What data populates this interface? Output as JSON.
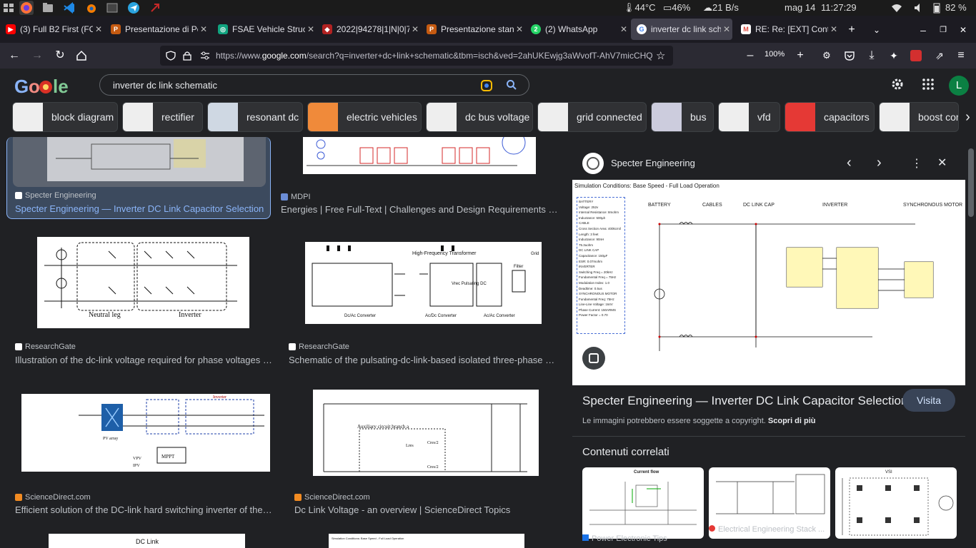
{
  "system": {
    "temperature": "44°C",
    "memory": "46%",
    "network": "21 B/s",
    "date": "mag 14",
    "time": "11:27:29",
    "battery": "82 %"
  },
  "tabs": [
    {
      "title": "(3) Full B2 First (FCE)",
      "color": "#ff0000",
      "glyph": "▶"
    },
    {
      "title": "Presentazione di Pov",
      "color": "#c55a11",
      "glyph": "P"
    },
    {
      "title": "FSAE Vehicle Structu",
      "color": "#10a37f",
      "glyph": "◎"
    },
    {
      "title": "2022|94278|1|N|0|74",
      "color": "#b22222",
      "glyph": "◆"
    },
    {
      "title": "Presentazione stand",
      "color": "#c55a11",
      "glyph": "P"
    },
    {
      "title": "(2) WhatsApp",
      "color": "#25d366",
      "glyph": "2"
    },
    {
      "title": "inverter dc link schen",
      "color": "#ffffff",
      "glyph": "G"
    },
    {
      "title": "RE: Re: [EXT] Contrat",
      "color": "#e04a3f",
      "glyph": "M"
    }
  ],
  "nav": {
    "url_prefix": "https://www.",
    "url_domain": "google.com",
    "url_rest": "/search?q=inverter+dc+link+schematic&tbm=isch&ved=2ahUKEwjg3aWvofT-AhV7micCHQV_D98Q",
    "zoom": "100%"
  },
  "google": {
    "query": "inverter dc link schematic",
    "avatar_letter": "L",
    "chips": [
      "block diagram",
      "rectifier",
      "resonant dc",
      "electric vehicles",
      "dc bus voltage",
      "grid connected",
      "bus",
      "vfd",
      "capacitors",
      "boost cor"
    ]
  },
  "results": [
    {
      "source": "Specter Engineering",
      "caption": "Specter Engineering — Inverter DC Link Capacitor Selection"
    },
    {
      "source": "MDPI",
      "caption": "Energies | Free Full-Text | Challenges and Design Requirements for ..."
    },
    {
      "source": "ResearchGate",
      "caption": "Illustration of the dc-link voltage required for phase voltages wit..."
    },
    {
      "source": "ResearchGate",
      "caption": "Schematic of the pulsating-dc-link-based isolated three-phase HF..."
    },
    {
      "source": "ScienceDirect.com",
      "caption": "Efficient solution of the DC-link hard switching inverter of the PV ..."
    },
    {
      "source": "ScienceDirect.com",
      "caption": "Dc Link Voltage - an overview | ScienceDirect Topics"
    }
  ],
  "thumbs": {
    "r2_left": {
      "neutral": "Neutral leg",
      "inverter": "Inverter"
    },
    "r2_right": {
      "hf": "High-Frequency Transformer",
      "vrec": "Vrec Pulsating DC",
      "filter": "Filter",
      "grid": "Grid",
      "dcdc": "Dc/Ac Converter",
      "acdc": "Ac/Dc Converter",
      "acac": "Ac/Ac Converter"
    },
    "r3_left": {
      "pv": "PV array",
      "mppt": "MPPT",
      "inverter": "Inverter",
      "dcdc": "dc/dc boost converter",
      "vpv": "VPV",
      "ipv": "IPV"
    },
    "r3_right": {
      "aux": "Auxiliary circuit branch a",
      "cres1": "Cres/2",
      "cres2": "Cres/2",
      "lres": "Lres"
    },
    "r4_left": {
      "dclink": "DC Link"
    },
    "r4_right": {
      "sim": "Simulation Conditions: Base Speed - Full Load Operation"
    }
  },
  "preview": {
    "source": "Specter Engineering",
    "title": "Specter Engineering — Inverter DC Link Capacitor Selection",
    "visit": "Visita",
    "copyright": "Le immagini potrebbero essere soggette a copyright.",
    "learn_more": "Scopri di più",
    "related_title": "Contenuti correlati",
    "related": [
      {
        "label": "Current flow",
        "source": "Power Electronic Tips"
      },
      {
        "label": "",
        "source": "Electrical Engineering Stack ..."
      },
      {
        "label": "VSI",
        "source": ""
      }
    ],
    "diagram": {
      "header": "Simulation Conditions: Base Speed - Full Load Operation",
      "columns": [
        "BATTERY",
        "CABLES",
        "DC LINK CAP",
        "INVERTER",
        "SYNCHRONOUS MOTOR"
      ],
      "notes": [
        "BATTERY",
        "Voltage: 252v",
        "Internal Resistance: 8mohm",
        "Inductance: 500µh",
        "CABLE",
        "Cross Section Area: 400kcmil",
        "Length: 3 feet",
        "Inductance: 90nH",
        "75.3uohm",
        "DC LINK CAP",
        "Capacitance: 150µF",
        "ESR: 0.07mohm",
        "INVERTER",
        "Switching Freq = 20kHz",
        "Fundamental Freq = 75Hz",
        "Modulation Index: 1.0",
        "Deadtime: 0.5us",
        "SYNCHRONOUS MOTOR",
        "Fundamental Freq: 75Hz",
        "Line-Line Voltage: 164V",
        "Phase Current: 150ARMS",
        "Power Factor = 0.70"
      ]
    }
  }
}
